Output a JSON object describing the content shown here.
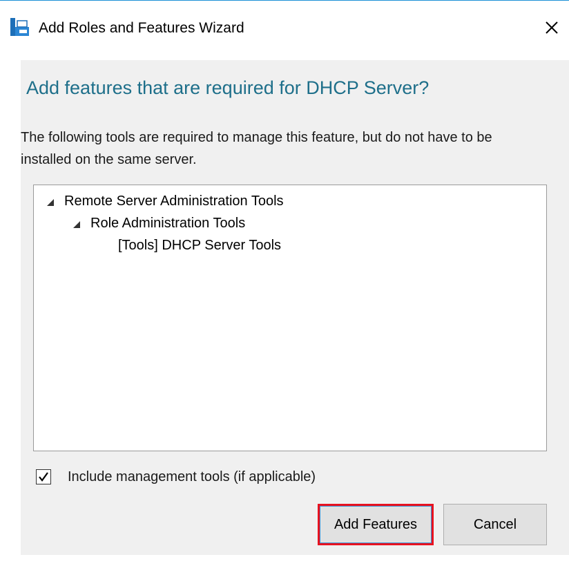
{
  "window": {
    "title": "Add Roles and Features Wizard",
    "accent_color": "#1b8fd6"
  },
  "icons": {
    "app": "server-manager-icon",
    "close": "close-icon",
    "expand": "expanded-triangle-icon",
    "check": "checkmark-icon"
  },
  "dialog": {
    "heading": "Add features that are required for DHCP Server?",
    "description": "The following tools are required to manage this feature, but do not have to be installed on the same server.",
    "tree": [
      {
        "label": "Remote Server Administration Tools",
        "expanded": true
      },
      {
        "label": "Role Administration Tools",
        "expanded": true
      },
      {
        "label": "[Tools] DHCP Server Tools"
      }
    ],
    "include_tools": {
      "label": "Include management tools (if applicable)",
      "checked": true
    },
    "buttons": {
      "add": "Add Features",
      "cancel": "Cancel"
    },
    "highlight_color": "#e8121f",
    "heading_color": "#1e6f8a"
  }
}
